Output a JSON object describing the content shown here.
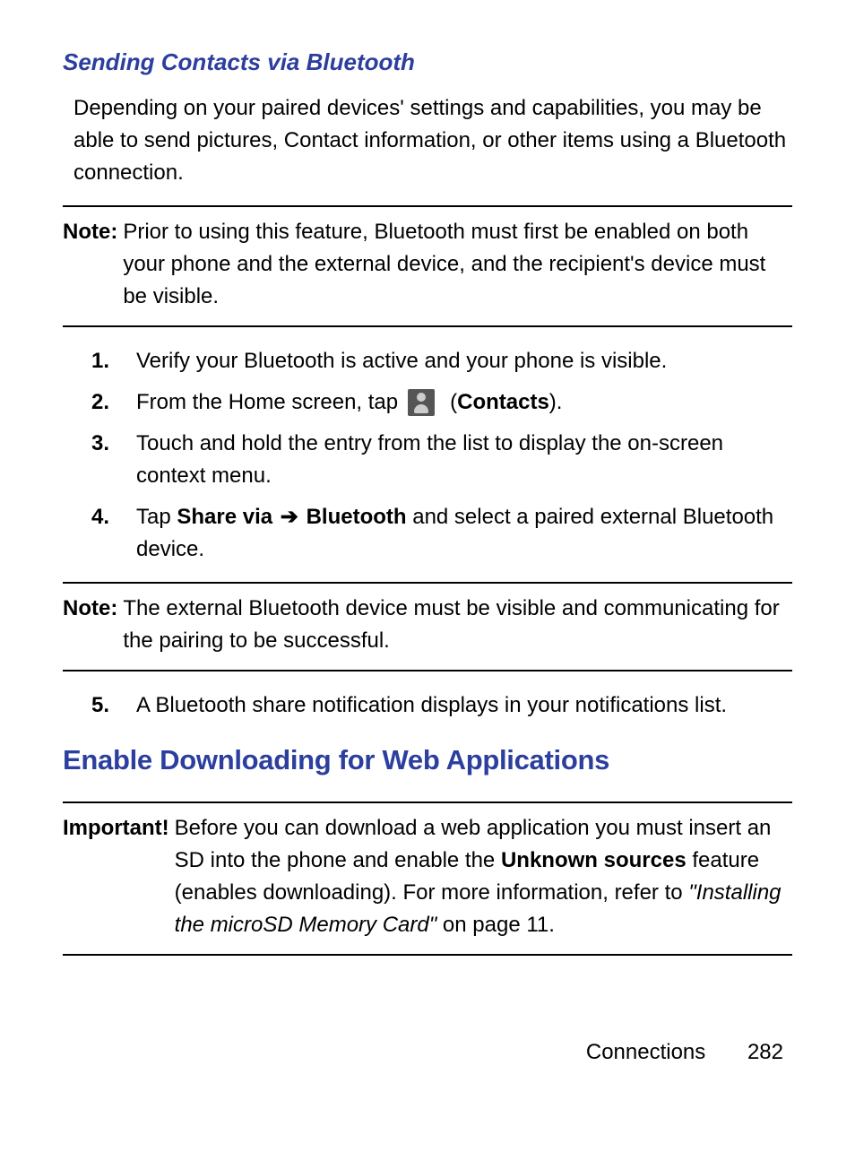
{
  "heading_sub": "Sending Contacts via Bluetooth",
  "intro": "Depending on your paired devices' settings and capabilities, you may be able to send pictures, Contact information, or other items using a Bluetooth connection.",
  "note1": {
    "label": "Note:",
    "body": "Prior to using this feature, Bluetooth must first be enabled on both your phone and the external device, and the recipient's device must be visible."
  },
  "steps": {
    "s1": "Verify your Bluetooth is active and your phone is visible.",
    "s2_pre": "From the Home screen, tap ",
    "s2_contacts": "Contacts",
    "s3": "Touch and hold the entry from the list to display the on-screen context menu.",
    "s4_pre": "Tap ",
    "s4_share": "Share via",
    "s4_arrow": "➔",
    "s4_bt": "Bluetooth",
    "s4_post": " and select a paired external Bluetooth device.",
    "s5": "A Bluetooth share notification displays in your notifications list."
  },
  "note2": {
    "label": "Note:",
    "body": "The external Bluetooth device must be visible and communicating for the pairing to be successful."
  },
  "heading_main": "Enable Downloading for Web Applications",
  "important": {
    "label": "Important!",
    "pre": "Before you can download a web application you must insert an SD into the phone and enable the ",
    "bold": "Unknown sources",
    "mid": " feature (enables downloading). For more information, refer to ",
    "italic": "\"Installing the microSD Memory Card\"",
    "post": " on page 11."
  },
  "footer": {
    "section": "Connections",
    "page": "282"
  }
}
